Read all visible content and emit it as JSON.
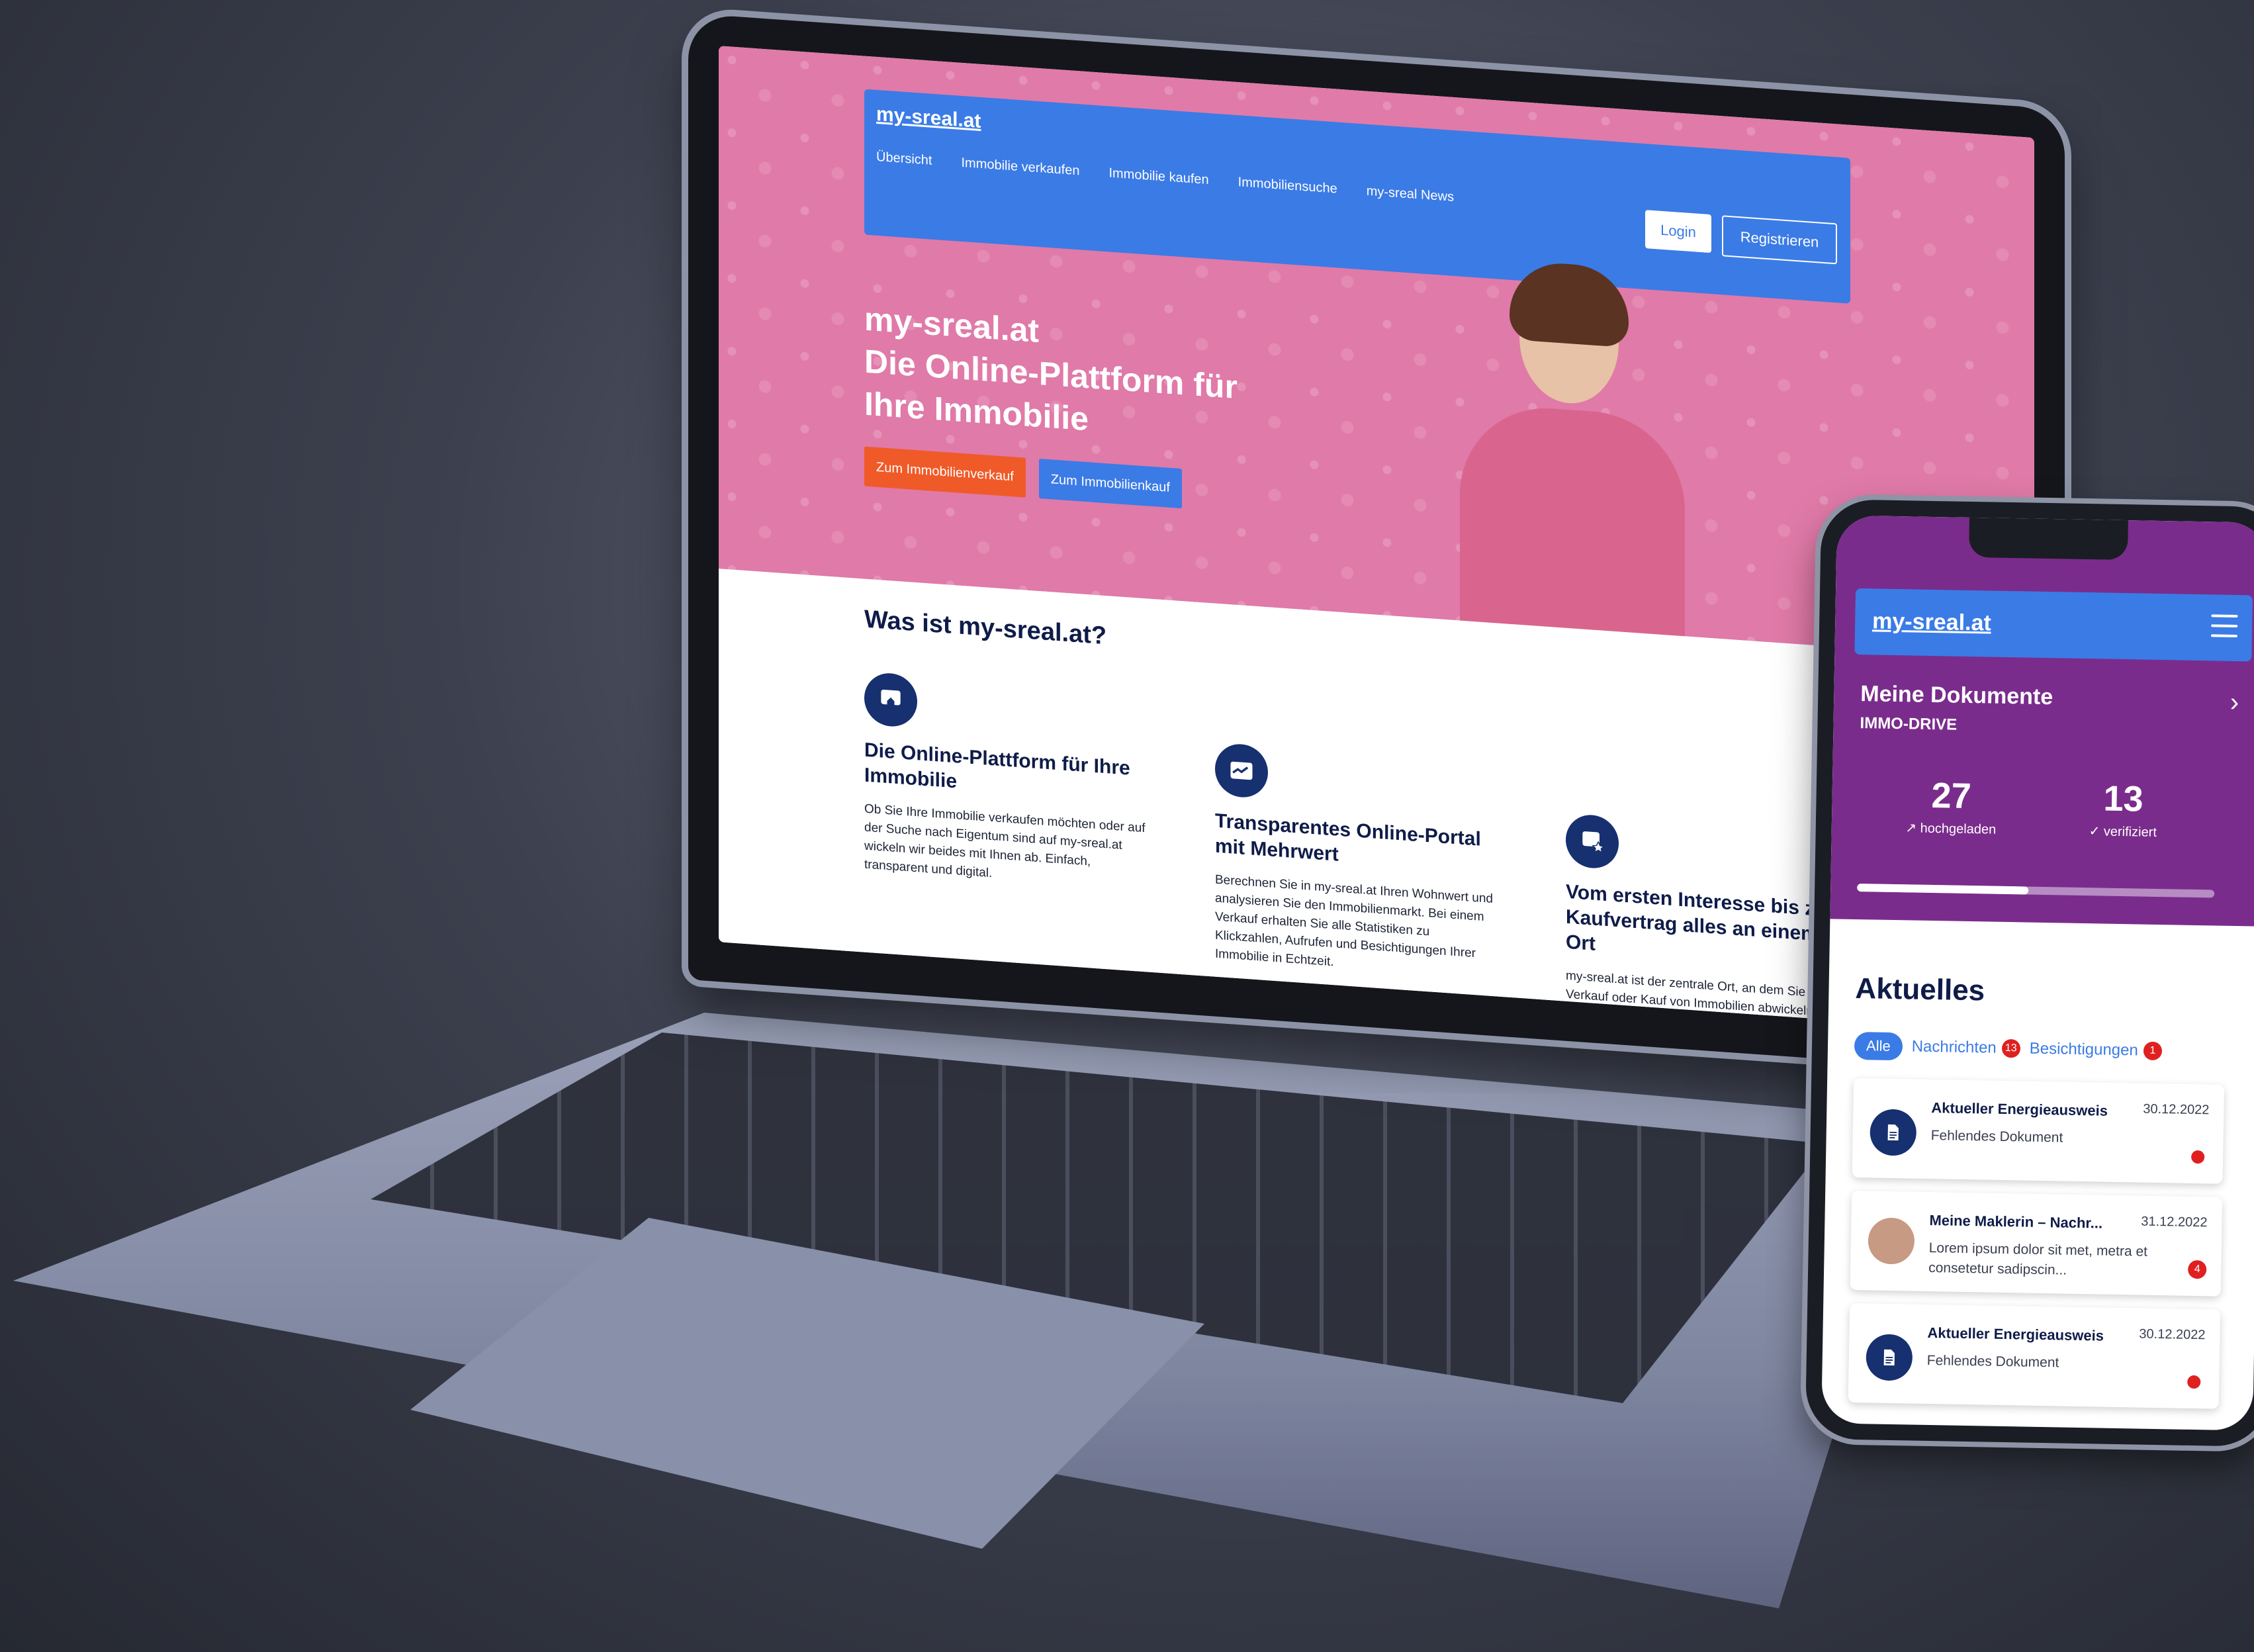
{
  "laptop": {
    "brand": "my-sreal.at",
    "nav": [
      "Übersicht",
      "Immobilie verkaufen",
      "Immobilie kaufen",
      "Immobiliensuche",
      "my-sreal News"
    ],
    "login": "Login",
    "register": "Registrieren",
    "hero_line1": "my-sreal.at",
    "hero_line2": "Die Online-Plattform für",
    "hero_line3": "Ihre Immobilie",
    "cta_sell": "Zum Immobilienverkauf",
    "cta_buy": "Zum Immobilienkauf",
    "what_title": "Was ist my-sreal.at?",
    "features": [
      {
        "title": "Die Online-Plattform für Ihre Immobilie",
        "text": "Ob Sie Ihre Immobilie verkaufen möchten oder auf der Suche nach Eigentum sind auf my-sreal.at wickeln wir beides mit Ihnen ab. Einfach, transparent und digital."
      },
      {
        "title": "Transparentes Online-Portal mit Mehrwert",
        "text": "Berechnen Sie in my-sreal.at Ihren Wohnwert und analysieren Sie den Immobilienmarkt. Bei einem Verkauf erhalten Sie alle Statistiken zu Klickzahlen, Aufrufen und Besichtigungen Ihrer Immobilie in Echtzeit."
      },
      {
        "title": "Vom ersten Interesse bis zum Kaufvertrag alles an einem Ort",
        "text": "my-sreal.at ist der zentrale Ort, an dem Sie den Verkauf oder Kauf von Immobilien abwickeln können: vom Chat mit Maklerinnen über die Dokumentenbibliothek bis zum digitalen Vertragsabschluss."
      }
    ]
  },
  "phone": {
    "brand": "my-sreal.at",
    "doc_title": "Meine Dokumente",
    "doc_sub": "IMMO-DRIVE",
    "stat_uploaded_value": "27",
    "stat_uploaded_label": "↗ hochgeladen",
    "stat_verified_value": "13",
    "stat_verified_label": "✓ verifiziert",
    "progress": 0.48,
    "section_title": "Aktuelles",
    "tab_all": "Alle",
    "tab_news": "Nachrichten",
    "tab_news_count": "13",
    "tab_viewings": "Besichtigungen",
    "tab_viewings_count": "1",
    "cards": [
      {
        "title": "Aktueller Energieausweis",
        "date": "30.12.2022",
        "desc": "Fehlendes Dokument"
      },
      {
        "title": "Meine Maklerin – Nachr...",
        "date": "31.12.2022",
        "desc": "Lorem ipsum dolor sit met, metra et consetetur sadipscin...",
        "count": "4"
      },
      {
        "title": "Aktueller Energieausweis",
        "date": "30.12.2022",
        "desc": "Fehlendes Dokument"
      }
    ]
  },
  "colors": {
    "hero_pink": "#e07aa8",
    "brand_blue": "#3b7be6",
    "navy": "#163070",
    "purple": "#7a2c8c",
    "orange": "#f05a28",
    "alert_red": "#e02020"
  }
}
